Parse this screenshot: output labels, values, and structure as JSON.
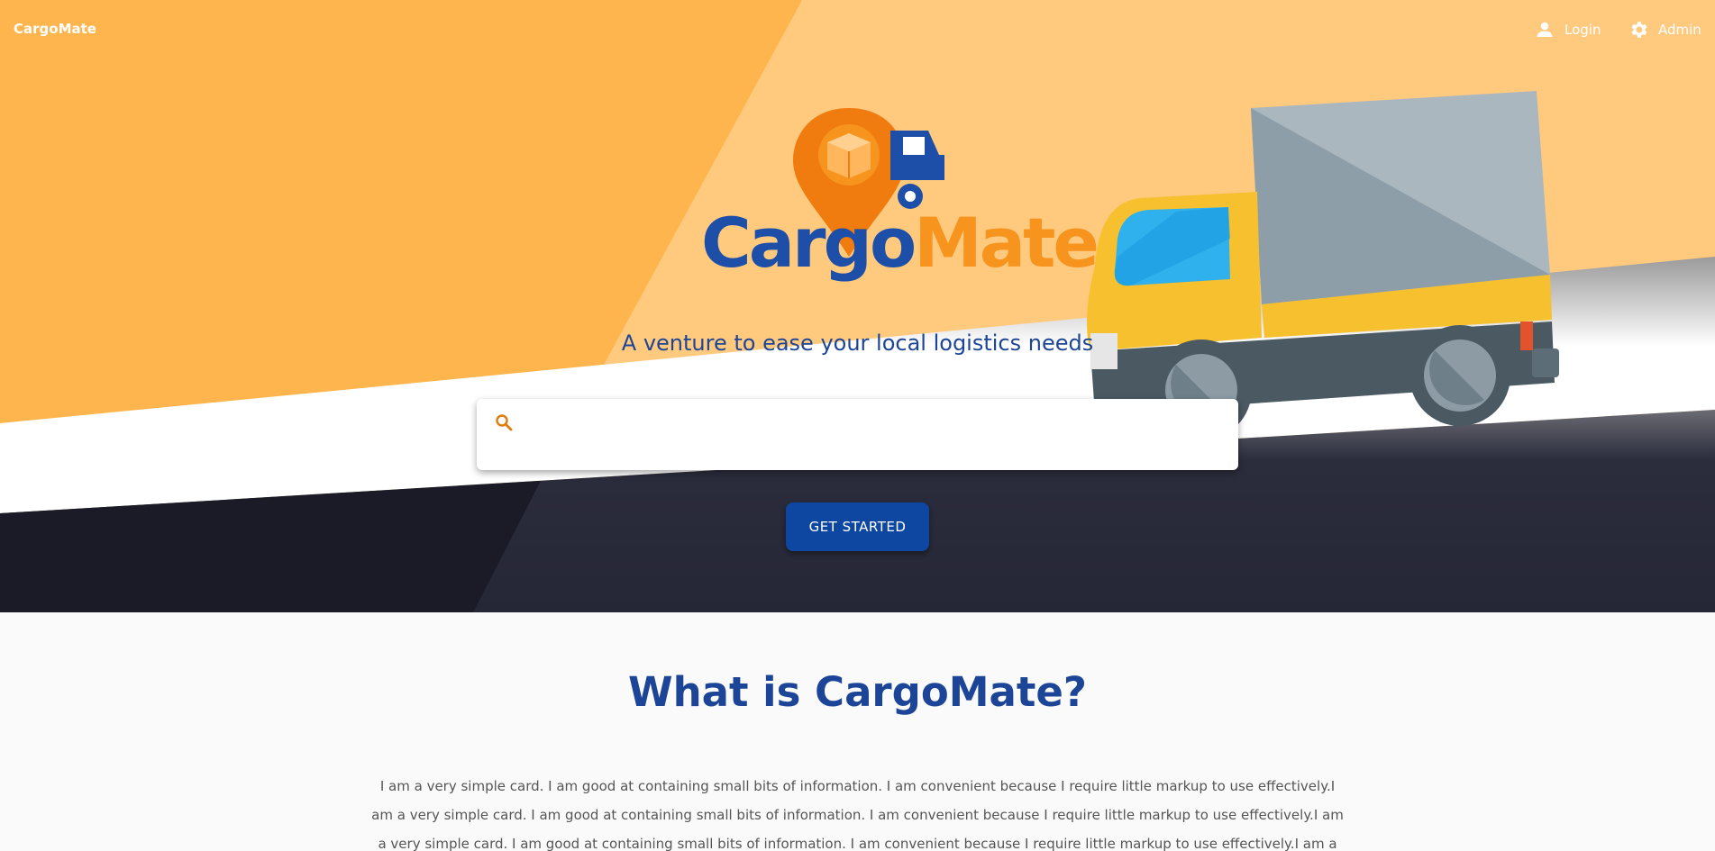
{
  "nav": {
    "brand": "CargoMate",
    "login_label": "Login",
    "admin_label": "Admin"
  },
  "logo": {
    "word_a": "Cargo",
    "word_b": "Mate"
  },
  "hero": {
    "tagline": "A venture to ease your local logistics needs",
    "search_placeholder": "",
    "cta_label": "GET STARTED"
  },
  "about": {
    "title": "What is CargoMate?",
    "body": "I am a very simple card. I am good at containing small bits of information. I am convenient because I require little markup to use effectively.I am a very simple card. I am good at containing small bits of information. I am convenient because I require little markup to use effectively.I am a very simple card. I am good at containing small bits of information. I am convenient because I require little markup to use effectively.I am a very simple card. I am good at containing small bits of information. I am"
  },
  "icons": {
    "login": "person-icon",
    "admin": "gear-icon",
    "search": "search-icon"
  },
  "colors": {
    "orange_dark": "#ffb54d",
    "orange_light": "#ffc97e",
    "navy": "#1e1f2e",
    "brand_blue": "#1e4fa8",
    "brand_orange": "#f7941d",
    "button_blue": "#0e47a1"
  }
}
